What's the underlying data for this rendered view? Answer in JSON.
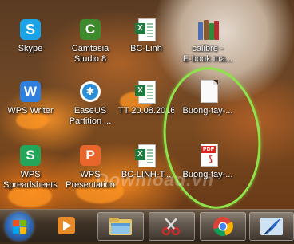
{
  "desktop_icons": {
    "skype": {
      "label": "Skype"
    },
    "camtasia": {
      "label_line1": "Camtasia",
      "label_line2": "Studio 8"
    },
    "bc_linh": {
      "label": "BC-Linh"
    },
    "calibre": {
      "label_line1": "calibre -",
      "label_line2": "E-book ma..."
    },
    "wps_writer": {
      "label": "WPS Writer"
    },
    "easeus": {
      "label_line1": "EaseUS",
      "label_line2": "Partition ..."
    },
    "tt_file": {
      "label": "TT 20.08.2016"
    },
    "buong_tay_doc": {
      "label": "Buong-tay-..."
    },
    "wps_spreadsheets": {
      "label_line1": "WPS",
      "label_line2": "Spreadsheets"
    },
    "wps_presentation": {
      "label_line1": "WPS",
      "label_line2": "Presentation"
    },
    "bc_linh_t": {
      "label": "BC-LINH-T..."
    },
    "buong_tay_pdf": {
      "label": "Buong-tay-...",
      "badge": "PDF"
    }
  },
  "watermark": "Download.vn",
  "taskbar": {
    "items": [
      "start-orb",
      "media-player",
      "file-explorer",
      "snipping-tool",
      "chrome",
      "ink-app"
    ]
  },
  "colors": {
    "highlight": "#8ee34a",
    "taskbar": "#3f3226"
  }
}
